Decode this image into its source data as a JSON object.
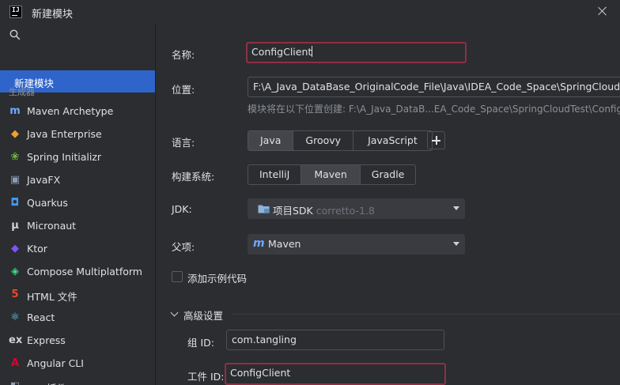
{
  "window": {
    "title": "新建模块",
    "logo_text": "IJ"
  },
  "sidebar": {
    "selected_label": "新建模块",
    "group_label": "生成器",
    "items": [
      {
        "label": "Maven Archetype",
        "icon": "maven-icon",
        "glyph": "m",
        "color": "#6fa8ff"
      },
      {
        "label": "Java Enterprise",
        "icon": "java-enterprise-icon",
        "glyph": "◆",
        "color": "#f0a030"
      },
      {
        "label": "Spring Initializr",
        "icon": "spring-icon",
        "glyph": "❀",
        "color": "#6db33f"
      },
      {
        "label": "JavaFX",
        "icon": "javafx-icon",
        "glyph": "▣",
        "color": "#8c9bb5"
      },
      {
        "label": "Quarkus",
        "icon": "quarkus-icon",
        "glyph": "◘",
        "color": "#4695eb"
      },
      {
        "label": "Micronaut",
        "icon": "micronaut-icon",
        "glyph": "μ",
        "color": "#cfd1d6"
      },
      {
        "label": "Ktor",
        "icon": "ktor-icon",
        "glyph": "◆",
        "color": "#7f52ff"
      },
      {
        "label": "Compose Multiplatform",
        "icon": "compose-icon",
        "glyph": "◈",
        "color": "#3ddc84"
      },
      {
        "label": "HTML 文件",
        "icon": "html5-icon",
        "glyph": "5",
        "color": "#e44d26"
      },
      {
        "label": "React",
        "icon": "react-icon",
        "glyph": "⚛",
        "color": "#61dafb"
      },
      {
        "label": "Express",
        "icon": "express-icon",
        "glyph": "ex",
        "color": "#cfd1d6"
      },
      {
        "label": "Angular CLI",
        "icon": "angular-icon",
        "glyph": "A",
        "color": "#dd0031"
      },
      {
        "label": "IDE 插件",
        "icon": "ide-plugin-icon",
        "glyph": "◧",
        "color": "#8c9bb5"
      }
    ]
  },
  "form": {
    "name_label": "名称:",
    "name_value": "ConfigClient",
    "location_label": "位置:",
    "location_value": "F:\\A_Java_DataBase_OriginalCode_File\\Java\\IDEA_Code_Space\\SpringCloudTest",
    "location_hint": "模块将在以下位置创建: F:\\A_Java_DataB...EA_Code_Space\\SpringCloudTest\\ConfigClient",
    "language_label": "语言:",
    "languages": [
      "Java",
      "Groovy",
      "JavaScript"
    ],
    "language_selected": "Java",
    "build_label": "构建系统:",
    "build_systems": [
      "IntelliJ",
      "Maven",
      "Gradle"
    ],
    "build_selected": "Maven",
    "jdk_label": "JDK:",
    "jdk_value": "项目SDK",
    "jdk_version": "corretto-1.8",
    "parent_label": "父项:",
    "parent_value": "Maven",
    "sample_code_label": "添加示例代码",
    "sample_code_checked": false,
    "advanced_label": "高级设置",
    "group_id_label": "组 ID:",
    "group_id_value": "com.tangling",
    "artifact_id_label": "工件 ID:",
    "artifact_id_value": "ConfigClient"
  },
  "colors": {
    "selection": "#2f65ca",
    "focus_border": "#8f2f45",
    "background": "#2b2d30"
  }
}
